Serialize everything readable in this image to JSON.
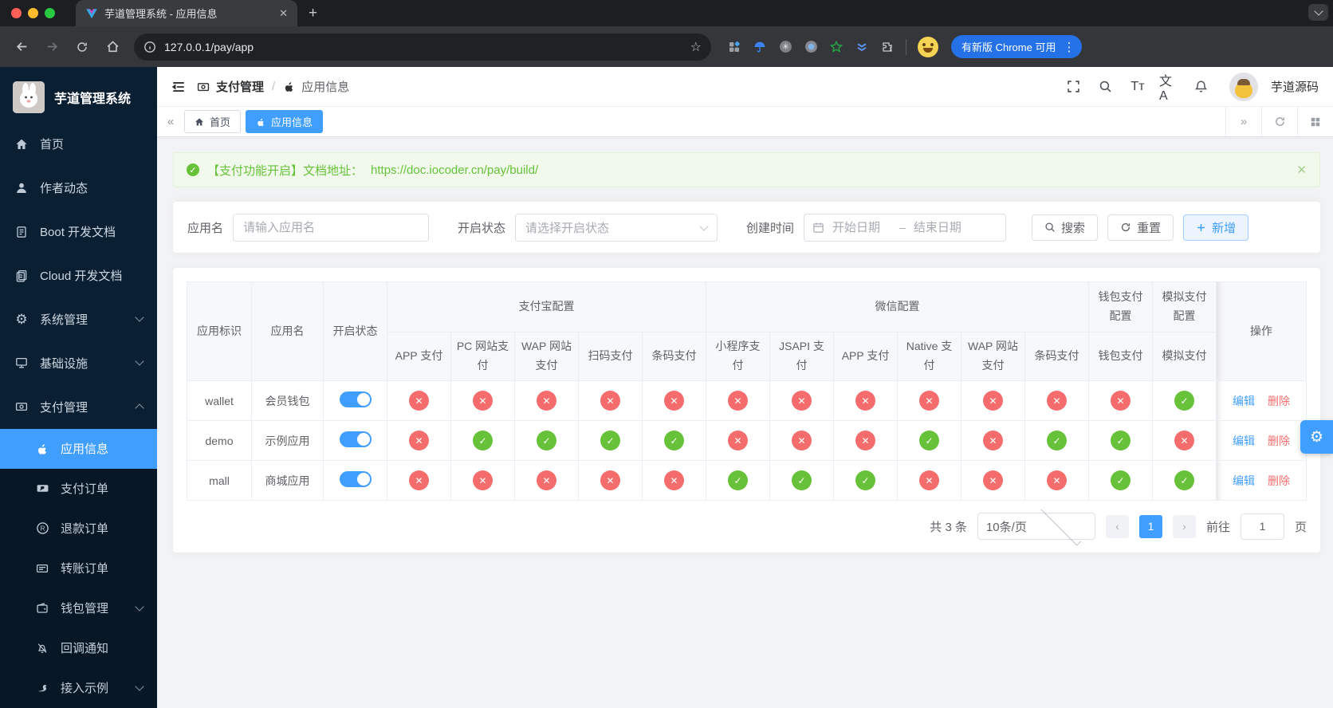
{
  "browser": {
    "tab_title": "芋道管理系统 - 应用信息",
    "url": "127.0.0.1/pay/app",
    "update_chip": "有新版 Chrome 可用"
  },
  "sidebar": {
    "brand": "芋道管理系统",
    "items": [
      {
        "label": "首页"
      },
      {
        "label": "作者动态"
      },
      {
        "label": "Boot 开发文档"
      },
      {
        "label": "Cloud 开发文档"
      },
      {
        "label": "系统管理"
      },
      {
        "label": "基础设施"
      },
      {
        "label": "支付管理"
      }
    ],
    "sub_items": [
      {
        "label": "应用信息"
      },
      {
        "label": "支付订单"
      },
      {
        "label": "退款订单"
      },
      {
        "label": "转账订单"
      },
      {
        "label": "钱包管理"
      },
      {
        "label": "回调通知"
      },
      {
        "label": "接入示例"
      }
    ]
  },
  "header": {
    "breadcrumb_1": "支付管理",
    "breadcrumb_2": "应用信息",
    "font_icon_text": "Tт",
    "lang_icon_text": "文A",
    "username": "芋道源码"
  },
  "tabs": {
    "home": "首页",
    "current": "应用信息"
  },
  "alert": {
    "text": "【支付功能开启】文档地址：",
    "link": "https://doc.iocoder.cn/pay/build/"
  },
  "filters": {
    "name_label": "应用名",
    "name_placeholder": "请输入应用名",
    "status_label": "开启状态",
    "status_placeholder": "请选择开启状态",
    "date_label": "创建时间",
    "date_start": "开始日期",
    "date_separator": "–",
    "date_end": "结束日期",
    "search": "搜索",
    "reset": "重置",
    "add": "新增"
  },
  "table": {
    "cols": {
      "app_id": "应用标识",
      "app_name": "应用名",
      "status": "开启状态",
      "alipay_group": "支付宝配置",
      "wechat_group": "微信配置",
      "wallet_group": "钱包支付配置",
      "mock_group": "模拟支付配置",
      "actions": "操作"
    },
    "alipay_cols": [
      "APP 支付",
      "PC 网站支付",
      "WAP 网站支付",
      "扫码支付",
      "条码支付"
    ],
    "wechat_cols": [
      "小程序支付",
      "JSAPI 支付",
      "APP 支付",
      "Native 支付",
      "WAP 网站支付",
      "条码支付"
    ],
    "wallet_col": "钱包支付",
    "mock_col": "模拟支付",
    "ops": {
      "edit": "编辑",
      "delete": "删除"
    },
    "rows": [
      {
        "app_id": "wallet",
        "app_name": "会员钱包",
        "enabled": true,
        "alipay": [
          "no",
          "no",
          "no",
          "no",
          "no"
        ],
        "wechat": [
          "no",
          "no",
          "no",
          "no",
          "no",
          "no"
        ],
        "wallet_pay": "no",
        "mock_pay": "yes"
      },
      {
        "app_id": "demo",
        "app_name": "示例应用",
        "enabled": true,
        "alipay": [
          "no",
          "yes",
          "yes",
          "yes",
          "yes"
        ],
        "wechat": [
          "no",
          "no",
          "no",
          "yes",
          "no",
          "yes"
        ],
        "wallet_pay": "yes",
        "mock_pay": "no"
      },
      {
        "app_id": "mall",
        "app_name": "商城应用",
        "enabled": true,
        "alipay": [
          "no",
          "no",
          "no",
          "no",
          "no"
        ],
        "wechat": [
          "yes",
          "yes",
          "yes",
          "no",
          "no",
          "no"
        ],
        "wallet_pay": "yes",
        "mock_pay": "yes"
      }
    ]
  },
  "status_glyphs": {
    "yes": "✓",
    "no": "✕"
  },
  "colors": {
    "accent": "#409eff",
    "success": "#67c23a",
    "danger": "#f56c6c",
    "sidebar": "#0b1f33"
  },
  "pagination": {
    "total": "共 3 条",
    "page_size": "10条/页",
    "prev": "‹",
    "page": "1",
    "next": "›",
    "goto_label": "前往",
    "goto_value": "1",
    "unit": "页"
  }
}
